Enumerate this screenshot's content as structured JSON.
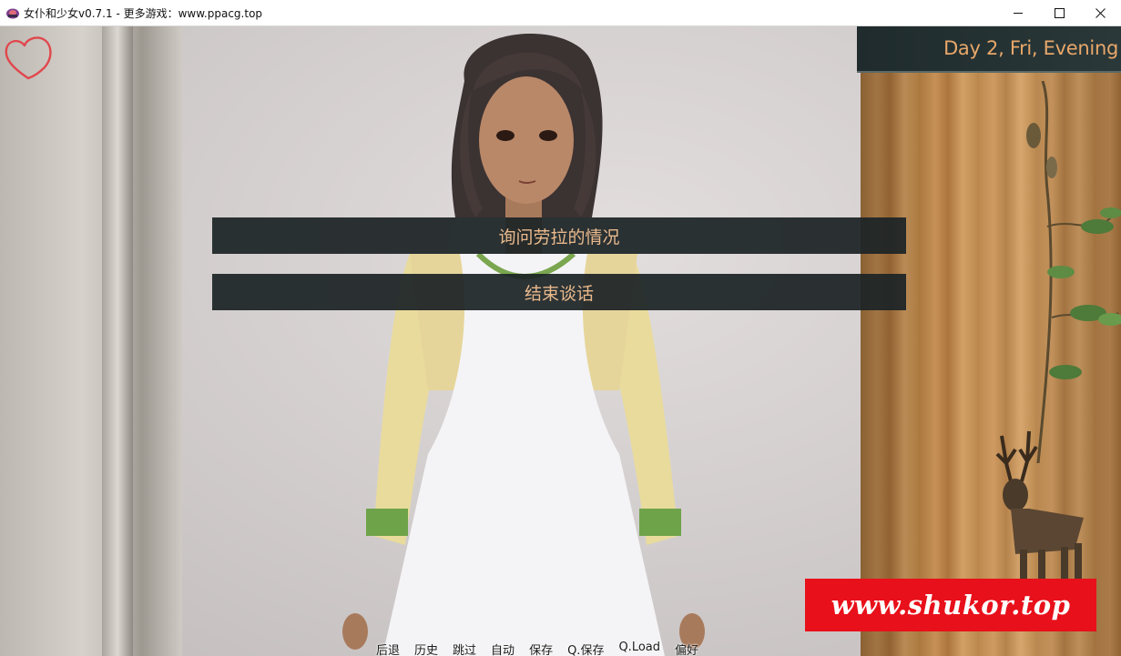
{
  "window": {
    "title": "女仆和少女v0.7.1 - 更多游戏：www.ppacg.top",
    "icon": "app-icon",
    "controls": [
      "minimize-icon",
      "maximize-icon",
      "close-icon"
    ]
  },
  "hud": {
    "affection_icon": "heart-icon",
    "date": "Day 2, Fri, Evening"
  },
  "choices": [
    {
      "label": "询问劳拉的情况"
    },
    {
      "label": "结束谈话"
    }
  ],
  "quick_menu": [
    {
      "label": "后退"
    },
    {
      "label": "历史"
    },
    {
      "label": "跳过"
    },
    {
      "label": "自动"
    },
    {
      "label": "保存"
    },
    {
      "label": "Q.保存"
    },
    {
      "label": "Q.Load"
    },
    {
      "label": "偏好"
    }
  ],
  "watermark": {
    "text": "www.shukor.top",
    "color": "#e8101a"
  },
  "colors": {
    "choice_bg": "#1c2426",
    "choice_text": "#e9b98c",
    "date_text": "#e8a76a",
    "heart": "#e0484e"
  }
}
